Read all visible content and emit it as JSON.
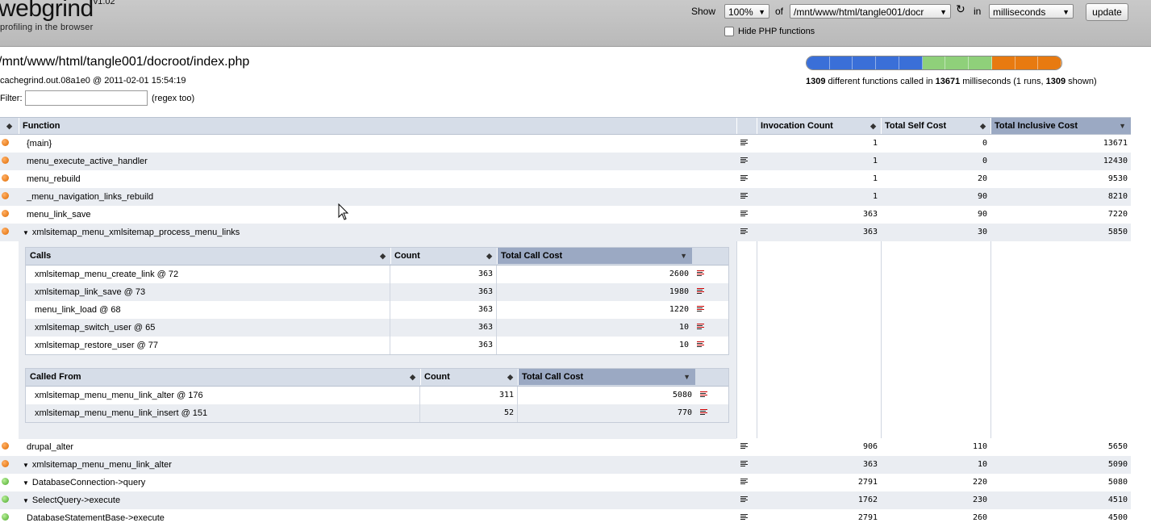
{
  "header": {
    "logo": "webgrind",
    "version": "v1.02",
    "tagline": "profiling in the browser",
    "show_label": "Show",
    "show_value": "100%",
    "of_label": "of",
    "file_value": "/mnt/www/html/tangle001/docr",
    "in_label": "in",
    "unit_value": "milliseconds",
    "update_label": "update",
    "hide_php_label": "Hide PHP functions",
    "hide_php_checked": false
  },
  "info": {
    "filepath": "/mnt/www/html/tangle001/docroot/index.php",
    "dataline": "cachegrind.out.08a1e0 @ 2011-02-01 15:54:19",
    "filter_label": "Filter:",
    "filter_value": "",
    "regex_label": "(regex too)",
    "summary": {
      "functions": "1309",
      "text1": " different functions called in ",
      "ms": "13671",
      "text2": " milliseconds (1 runs, ",
      "shown": "1309",
      "text3": " shown)"
    },
    "cost_bar_colors": [
      "#3a6fd8",
      "#3a6fd8",
      "#3a6fd8",
      "#3a6fd8",
      "#3a6fd8",
      "#8fd07a",
      "#8fd07a",
      "#8fd07a",
      "#e87a10",
      "#e87a10",
      "#e87a10"
    ]
  },
  "table": {
    "headers": {
      "function": "Function",
      "invocation": "Invocation Count",
      "self": "Total Self Cost",
      "inclusive": "Total Inclusive Cost"
    },
    "rows": [
      {
        "name": "{main}",
        "dot": "orange",
        "expanded": false,
        "arrow": false,
        "invocation": "1",
        "self": "0",
        "inclusive": "13671"
      },
      {
        "name": "menu_execute_active_handler",
        "dot": "orange",
        "expanded": false,
        "arrow": false,
        "invocation": "1",
        "self": "0",
        "inclusive": "12430"
      },
      {
        "name": "menu_rebuild",
        "dot": "orange",
        "expanded": false,
        "arrow": false,
        "invocation": "1",
        "self": "20",
        "inclusive": "9530"
      },
      {
        "name": "_menu_navigation_links_rebuild",
        "dot": "orange",
        "expanded": false,
        "arrow": false,
        "invocation": "1",
        "self": "90",
        "inclusive": "8210"
      },
      {
        "name": "menu_link_save",
        "dot": "orange",
        "expanded": false,
        "arrow": false,
        "invocation": "363",
        "self": "90",
        "inclusive": "7220"
      },
      {
        "name": "xmlsitemap_menu_xmlsitemap_process_menu_links",
        "dot": "orange",
        "expanded": true,
        "arrow": true,
        "invocation": "363",
        "self": "30",
        "inclusive": "5850"
      },
      {
        "name": "drupal_alter",
        "dot": "orange",
        "expanded": false,
        "arrow": false,
        "invocation": "906",
        "self": "110",
        "inclusive": "5650"
      },
      {
        "name": "xmlsitemap_menu_menu_link_alter",
        "dot": "orange",
        "expanded": false,
        "arrow": true,
        "invocation": "363",
        "self": "10",
        "inclusive": "5090"
      },
      {
        "name": "DatabaseConnection->query",
        "dot": "green",
        "expanded": false,
        "arrow": true,
        "invocation": "2791",
        "self": "220",
        "inclusive": "5080"
      },
      {
        "name": "SelectQuery->execute",
        "dot": "green",
        "expanded": false,
        "arrow": true,
        "invocation": "1762",
        "self": "230",
        "inclusive": "4510"
      },
      {
        "name": "DatabaseStatementBase->execute",
        "dot": "green",
        "expanded": false,
        "arrow": false,
        "invocation": "2791",
        "self": "260",
        "inclusive": "4500"
      }
    ]
  },
  "calls": {
    "headers": {
      "name": "Calls",
      "count": "Count",
      "cost": "Total Call Cost"
    },
    "rows": [
      {
        "name": "xmlsitemap_menu_create_link @ 72",
        "count": "363",
        "cost": "2600"
      },
      {
        "name": "xmlsitemap_link_save @ 73",
        "count": "363",
        "cost": "1980"
      },
      {
        "name": "menu_link_load @ 68",
        "count": "363",
        "cost": "1220"
      },
      {
        "name": "xmlsitemap_switch_user @ 65",
        "count": "363",
        "cost": "10"
      },
      {
        "name": "xmlsitemap_restore_user @ 77",
        "count": "363",
        "cost": "10"
      }
    ]
  },
  "called_from": {
    "headers": {
      "name": "Called From",
      "count": "Count",
      "cost": "Total Call Cost"
    },
    "rows": [
      {
        "name": "xmlsitemap_menu_menu_link_alter @ 176",
        "count": "311",
        "cost": "5080"
      },
      {
        "name": "xmlsitemap_menu_menu_link_insert @ 151",
        "count": "52",
        "cost": "770"
      }
    ]
  }
}
